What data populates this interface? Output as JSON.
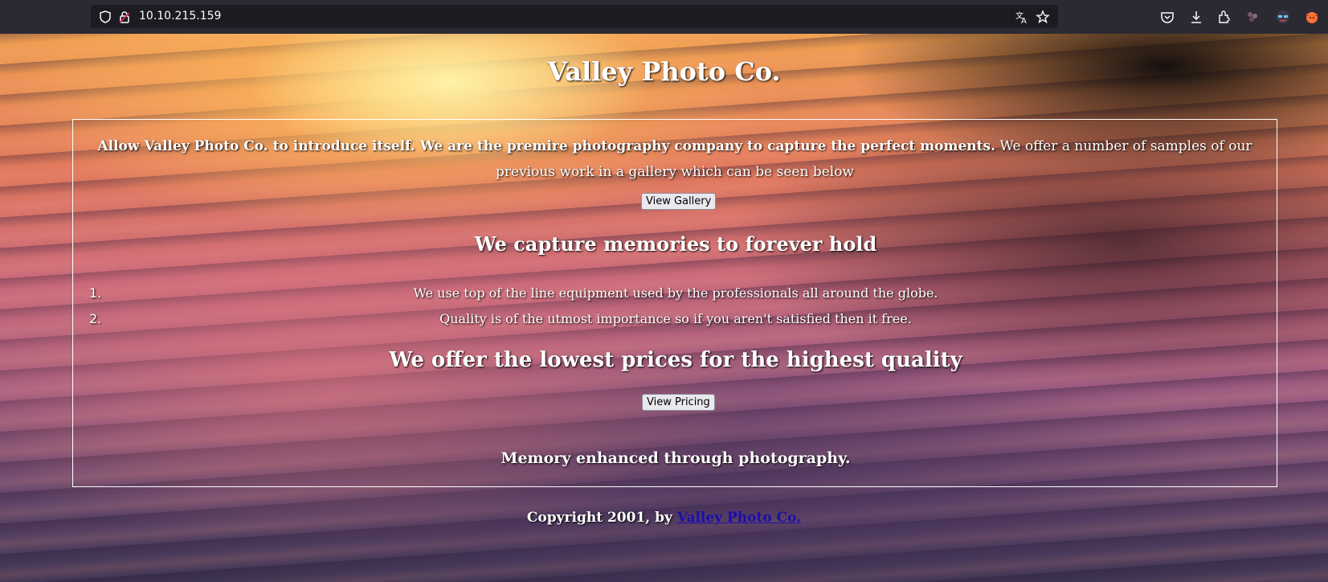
{
  "browser": {
    "url": "10.10.215.159",
    "icons": [
      "shield-icon",
      "lock-icon",
      "translate-icon",
      "star-icon",
      "pocket-icon",
      "download-icon",
      "extensions-icon",
      "container-icon",
      "account-icon",
      "fox-icon"
    ]
  },
  "page": {
    "title": "Valley Photo Co.",
    "intro_bold": "Allow Valley Photo Co. to introduce itself. We are the premire photography company to capture the perfect moments.",
    "intro_rest": " We offer a number of samples of our previous work in a gallery which can be seen below",
    "gallery_button": "View Gallery",
    "memories_heading": "We capture memories to forever hold",
    "list": [
      {
        "num": "1.",
        "text": "We use top of the line equipment used by the professionals all around the globe."
      },
      {
        "num": "2.",
        "text": "Quality is of the utmost importance so if you aren't satisfied then it free."
      }
    ],
    "prices_heading": "We offer the lowest prices for the highest quality",
    "pricing_button": "View Pricing",
    "tagline": "Memory enhanced through photography.",
    "footer_text": "Copyright 2001, by ",
    "footer_link": "Valley Photo Co."
  }
}
